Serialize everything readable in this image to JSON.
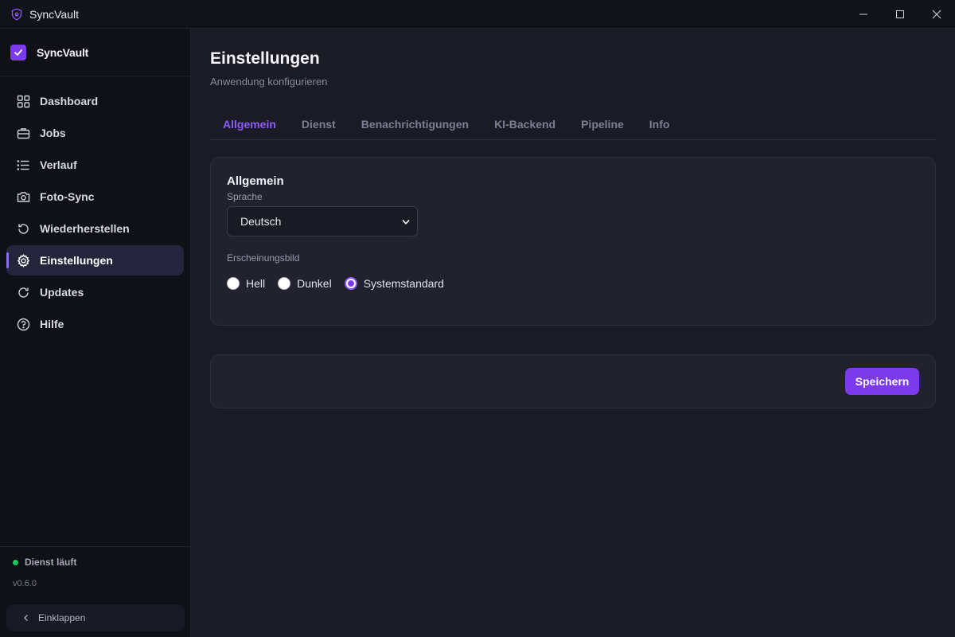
{
  "window": {
    "title": "SyncVault",
    "icon": "shield-lock-icon",
    "controls": [
      "minimize-icon",
      "maximize-icon",
      "close-icon"
    ]
  },
  "sidebar": {
    "brand": {
      "name": "SyncVault",
      "icon": "checkbox-logo-icon"
    },
    "items": [
      {
        "label": "Dashboard",
        "icon": "grid-icon",
        "active": false
      },
      {
        "label": "Jobs",
        "icon": "briefcase-icon",
        "active": false
      },
      {
        "label": "Verlauf",
        "icon": "list-icon",
        "active": false
      },
      {
        "label": "Foto-Sync",
        "icon": "camera-icon",
        "active": false
      },
      {
        "label": "Wiederherstellen",
        "icon": "restore-icon",
        "active": false
      },
      {
        "label": "Einstellungen",
        "icon": "gear-icon",
        "active": true
      },
      {
        "label": "Updates",
        "icon": "refresh-icon",
        "active": false
      },
      {
        "label": "Hilfe",
        "icon": "help-icon",
        "active": false
      }
    ],
    "footer": {
      "status": "Dienst läuft",
      "status_color": "#22c55e",
      "version": "v0.6.0",
      "collapse_label": "Einklappen"
    }
  },
  "main": {
    "title": "Einstellungen",
    "subtitle": "Anwendung konfigurieren",
    "tabs": [
      {
        "label": "Allgemein",
        "active": true
      },
      {
        "label": "Dienst",
        "active": false
      },
      {
        "label": "Benachrichtigungen",
        "active": false
      },
      {
        "label": "KI-Backend",
        "active": false
      },
      {
        "label": "Pipeline",
        "active": false
      },
      {
        "label": "Info",
        "active": false
      }
    ],
    "general": {
      "title": "Allgemein",
      "language_label": "Sprache",
      "language_value": "Deutsch",
      "appearance_label": "Erscheinungsbild",
      "appearance_options": [
        {
          "label": "Hell",
          "checked": false
        },
        {
          "label": "Dunkel",
          "checked": false
        },
        {
          "label": "Systemstandard",
          "checked": true
        }
      ]
    },
    "save_label": "Speichern"
  },
  "colors": {
    "accent": "#7c3aed",
    "background": "#1b1b26",
    "sidebar": "#101017",
    "card": "#22222f"
  }
}
